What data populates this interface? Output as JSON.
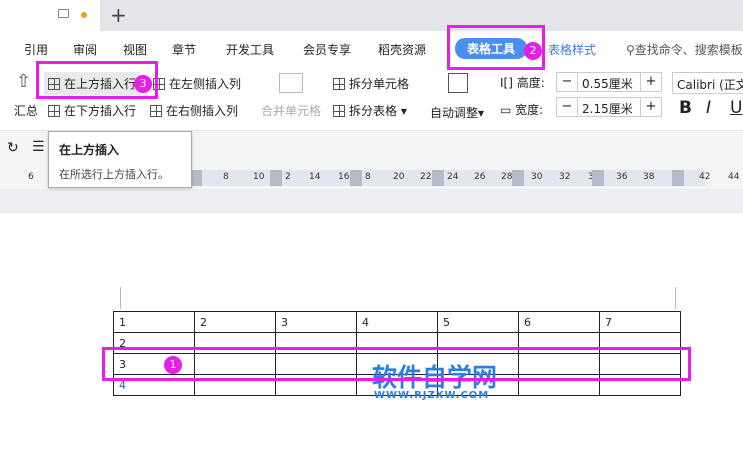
{
  "tabs": {
    "new_tab": "+"
  },
  "menu": {
    "items": [
      "引用",
      "审阅",
      "视图",
      "章节",
      "开发工具",
      "会员专享",
      "稻壳资源"
    ],
    "active": "表格工具",
    "style": "表格样式",
    "search": "查找命令、搜索模板"
  },
  "ribbon": {
    "summary": "汇总",
    "insert_above": "在上方插入行",
    "insert_below": "在下方插入行",
    "insert_left": "在左侧插入列",
    "insert_right": "在右侧插入列",
    "merge": "合并单元格",
    "split_cell": "拆分单元格",
    "split_table": "拆分表格",
    "auto_fit": "自动调整",
    "height_label": "高度:",
    "height_value": "0.55厘米",
    "width_label": "宽度:",
    "width_value": "2.15厘米",
    "font": "Calibri (正文",
    "bold": "B",
    "italic": "I",
    "underline": "U",
    "minus": "−",
    "plus": "+"
  },
  "tooltip": {
    "title": "在上方插入",
    "desc": "在所选行上方插入行。"
  },
  "ruler": {
    "ticks": [
      "6",
      "8",
      "10",
      "2",
      "14",
      "16",
      "8",
      "20",
      "22",
      "24",
      "26",
      "28",
      "30",
      "32",
      "34",
      "36",
      "38",
      "4",
      "42",
      "44"
    ]
  },
  "table": {
    "rows": [
      [
        "1",
        "2",
        "3",
        "4",
        "5",
        "6",
        "7"
      ],
      [
        "2",
        "",
        "",
        "",
        "",
        "",
        ""
      ],
      [
        "3",
        "",
        "",
        "",
        "",
        "",
        ""
      ],
      [
        "4",
        "",
        "",
        "",
        "",
        "",
        ""
      ]
    ]
  },
  "annotations": {
    "b1": "1",
    "b2": "2",
    "b3": "3"
  },
  "watermark": {
    "title": "软件自学网",
    "url": "WWW.RJZXW.COM"
  },
  "colors": {
    "accent": "#4a8ef0",
    "annotation": "#e81ee8"
  }
}
